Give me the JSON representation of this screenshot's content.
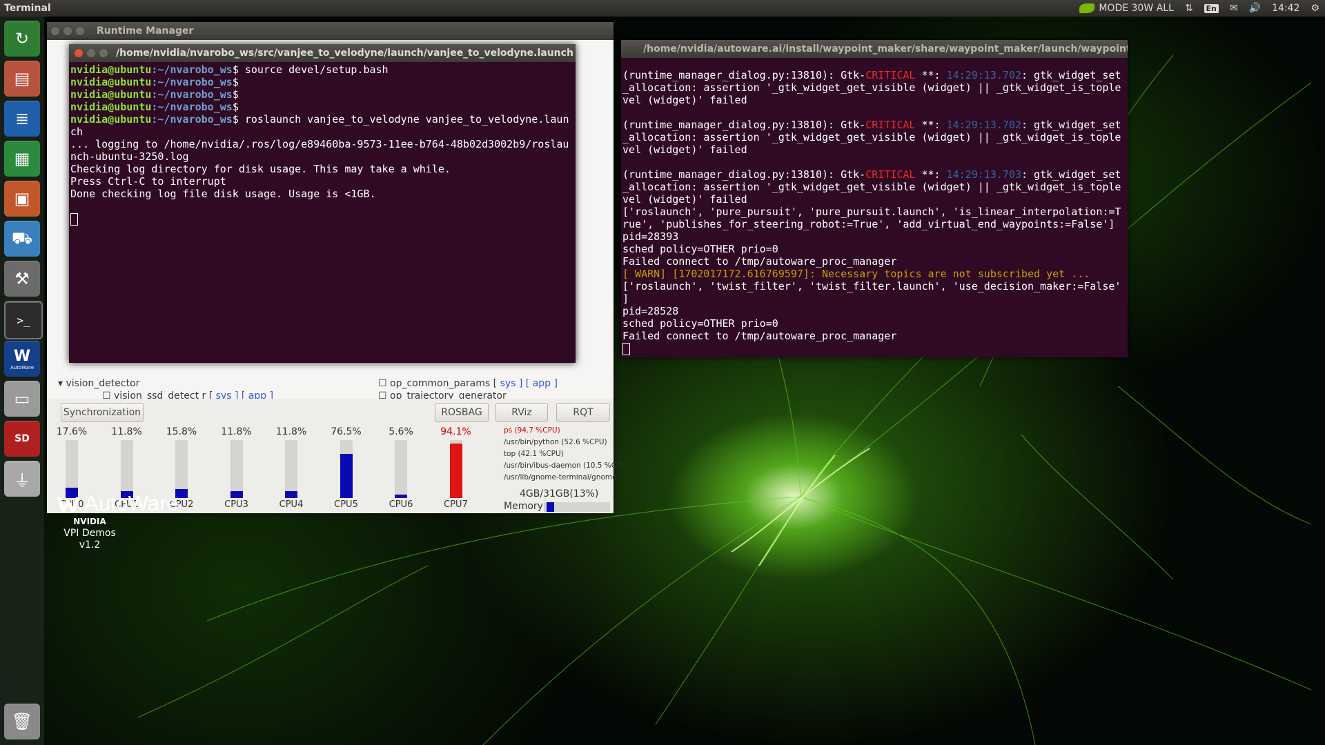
{
  "top_panel": {
    "app_title": "Terminal",
    "power_mode": "MODE 30W ALL",
    "keyboard_lang": "En",
    "clock": "14:42"
  },
  "launcher": {
    "items": [
      "software-updater-icon",
      "files-icon",
      "writer-icon",
      "calc-icon",
      "impress-icon",
      "software-center-icon",
      "system-settings-icon",
      "terminal-icon",
      "autoware-icon",
      "drive-icon",
      "sd-card-icon",
      "usb-icon",
      "trash-icon"
    ],
    "autoware_label": "AutoWare"
  },
  "runtime_manager": {
    "title": "Runtime Manager",
    "tree_rows": [
      {
        "label": "vision_detector",
        "tags": ""
      },
      {
        "label": "vision_ssd_detect r",
        "tags": "sys ] [ app ]"
      },
      {
        "label": "op_common_params",
        "tags": "sys ] [ app ]"
      },
      {
        "label": "op_trajectory_generator",
        "tags": ""
      }
    ],
    "buttons": {
      "sync": "Synchronization",
      "rosbag": "ROSBAG",
      "rviz": "RViz",
      "rqt": "RQT"
    },
    "cpus": [
      {
        "label": "CPU0",
        "pct_text": "17.6%",
        "value": 17.6,
        "hot": false
      },
      {
        "label": "CPU1",
        "pct_text": "11.8%",
        "value": 11.8,
        "hot": false
      },
      {
        "label": "CPU2",
        "pct_text": "15.8%",
        "value": 15.8,
        "hot": false
      },
      {
        "label": "CPU3",
        "pct_text": "11.8%",
        "value": 11.8,
        "hot": false
      },
      {
        "label": "CPU4",
        "pct_text": "11.8%",
        "value": 11.8,
        "hot": false
      },
      {
        "label": "CPU5",
        "pct_text": "76.5%",
        "value": 76.5,
        "hot": false
      },
      {
        "label": "CPU6",
        "pct_text": "5.6%",
        "value": 5.6,
        "hot": false
      },
      {
        "label": "CPU7",
        "pct_text": "94.1%",
        "value": 94.1,
        "hot": true
      }
    ],
    "processes": [
      {
        "text": "ps (94.7 %CPU)",
        "hot": true
      },
      {
        "text": "/usr/bin/python (52.6 %CPU)",
        "hot": false
      },
      {
        "text": "top (42.1 %CPU)",
        "hot": false
      },
      {
        "text": "/usr/bin/ibus-daemon (10.5 %CPU",
        "hot": false
      },
      {
        "text": "/usr/lib/gnome-terminal/gnome-",
        "hot": false
      }
    ],
    "memory_text": "4GB/31GB(13%)",
    "memory_label": "Memory",
    "memory_value": 13
  },
  "autoware_brand": "AutoWare",
  "vpi": {
    "brand": "NVIDIA",
    "line1": "VPI Demos",
    "line2": "v1.2"
  },
  "terminal_left": {
    "title": "/home/nvidia/nvarobo_ws/src/vanjee_to_velodyne/launch/vanjee_to_velodyne.launch",
    "prompt_user": "nvidia@ubuntu",
    "prompt_path": ":~/nvarobo_ws",
    "lines": [
      {
        "prompt": true,
        "cmd": "$ source devel/setup.bash"
      },
      {
        "prompt": true,
        "cmd": "$"
      },
      {
        "prompt": true,
        "cmd": "$"
      },
      {
        "prompt": true,
        "cmd": "$"
      },
      {
        "prompt": true,
        "cmd": "$ roslaunch vanjee_to_velodyne vanjee_to_velodyne.laun"
      },
      {
        "prompt": false,
        "cmd": "ch"
      },
      {
        "prompt": false,
        "cmd": "... logging to /home/nvidia/.ros/log/e89460ba-9573-11ee-b764-48b02d3002b9/roslau"
      },
      {
        "prompt": false,
        "cmd": "nch-ubuntu-3250.log"
      },
      {
        "prompt": false,
        "cmd": "Checking log directory for disk usage. This may take a while."
      },
      {
        "prompt": false,
        "cmd": "Press Ctrl-C to interrupt"
      },
      {
        "prompt": false,
        "cmd": "Done checking log file disk usage. Usage is <1GB."
      }
    ]
  },
  "terminal_right": {
    "title": "/home/nvidia/autoware.ai/install/waypoint_maker/share/waypoint_maker/launch/waypoint",
    "gtk_errors": [
      {
        "pre": "(runtime_manager_dialog.py:13810): Gtk-",
        "level": "CRITICAL",
        "mid": " **: ",
        "time": "14:29:13.702",
        "post": ": gtk_widget_set"
      },
      {
        "pre": "(runtime_manager_dialog.py:13810): Gtk-",
        "level": "CRITICAL",
        "mid": " **: ",
        "time": "14:29:13.702",
        "post": ": gtk_widget_set"
      },
      {
        "pre": "(runtime_manager_dialog.py:13810): Gtk-",
        "level": "CRITICAL",
        "mid": " **: ",
        "time": "14:29:13.703",
        "post": ": gtk_widget_set"
      }
    ],
    "gtk_error_tail": [
      "_allocation: assertion '_gtk_widget_get_visible (widget) || _gtk_widget_is_tople",
      "vel (widget)' failed"
    ],
    "tail_lines": [
      {
        "text": "['roslaunch', 'pure_pursuit', 'pure_pursuit.launch', 'is_linear_interpolation:=T",
        "warn": false
      },
      {
        "text": "rue', 'publishes_for_steering_robot:=True', 'add_virtual_end_waypoints:=False']",
        "warn": false
      },
      {
        "text": "pid=28393",
        "warn": false
      },
      {
        "text": "sched policy=OTHER prio=0",
        "warn": false
      },
      {
        "text": "Failed connect to /tmp/autoware_proc_manager",
        "warn": false
      },
      {
        "text": "[ WARN] [1702017172.616769597]: Necessary topics are not subscribed yet ...",
        "warn": true
      },
      {
        "text": "['roslaunch', 'twist_filter', 'twist_filter.launch', 'use_decision_maker:=False'",
        "warn": false
      },
      {
        "text": "]",
        "warn": false
      },
      {
        "text": "pid=28528",
        "warn": false
      },
      {
        "text": "sched policy=OTHER prio=0",
        "warn": false
      },
      {
        "text": "Failed connect to /tmp/autoware_proc_manager",
        "warn": false
      }
    ]
  }
}
